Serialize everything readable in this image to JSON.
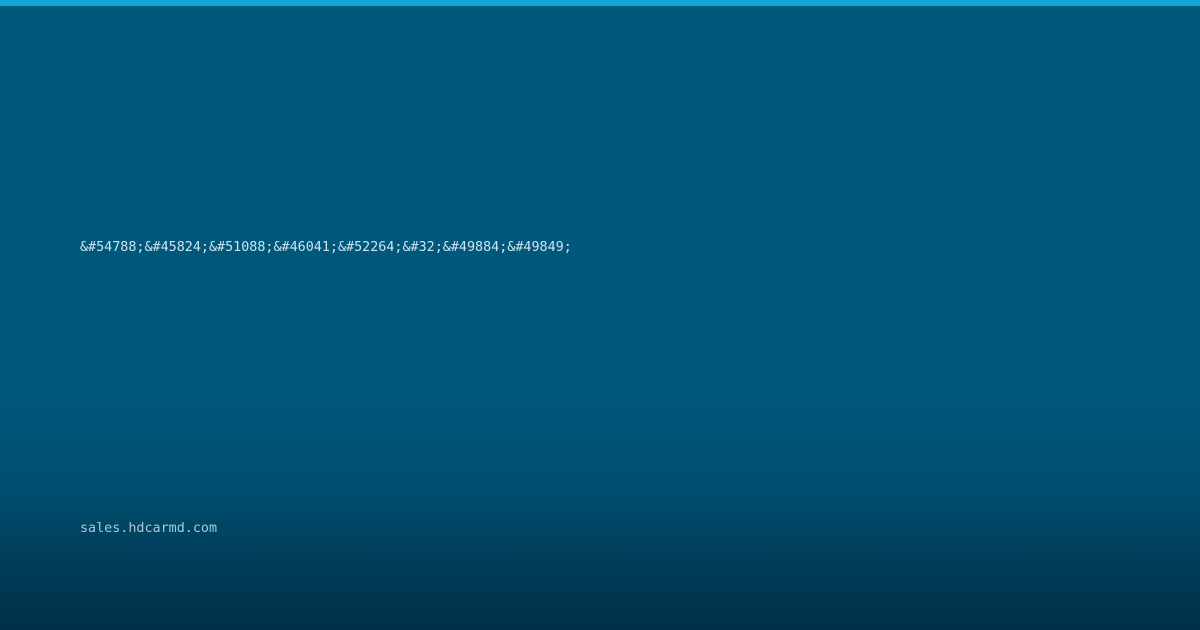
{
  "card": {
    "title": "&#54788;&#45824;&#51088;&#46041;&#52264;&#32;&#49884;&#49849;",
    "domain": "sales.hdcarmd.com"
  },
  "colors": {
    "accent_bar": "#14a6d6",
    "background_top": "#00587d",
    "background_bottom": "#00304a",
    "title_text": "#cfe3ee",
    "domain_text": "#a9c8d8"
  }
}
